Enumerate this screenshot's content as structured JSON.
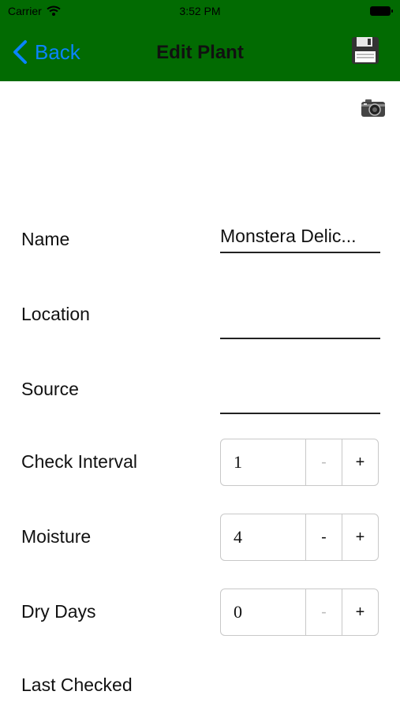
{
  "status_bar": {
    "carrier": "Carrier",
    "time": "3:52 PM"
  },
  "nav": {
    "back_label": "Back",
    "title": "Edit Plant"
  },
  "colors": {
    "nav_background": "#026b02",
    "back_color": "#0a84ff"
  },
  "form": {
    "name": {
      "label": "Name",
      "value": "Monstera Delic..."
    },
    "location": {
      "label": "Location",
      "value": ""
    },
    "source": {
      "label": "Source",
      "value": ""
    },
    "check_interval": {
      "label": "Check Interval",
      "value": "1",
      "minus": "-",
      "plus": "+"
    },
    "moisture": {
      "label": "Moisture",
      "value": "4",
      "minus": "-",
      "plus": "+"
    },
    "dry_days": {
      "label": "Dry Days",
      "value": "0",
      "minus": "-",
      "plus": "+"
    },
    "last_checked": {
      "label": "Last Checked"
    }
  }
}
